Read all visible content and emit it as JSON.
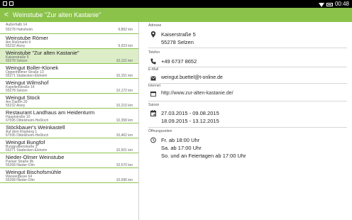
{
  "status_bar": {
    "time": "00:48",
    "icons": [
      "square-icon",
      "square-icon",
      "wifi-icon",
      "battery-icon"
    ]
  },
  "toolbar": {
    "back_glyph": "<",
    "title": "Weinstube \"Zur alten Kastanie\""
  },
  "list": {
    "items": [
      {
        "name": "",
        "street": "Außerhalb 14",
        "city": "55278 Hahnheim",
        "distance": "9,892 km"
      },
      {
        "name": "Weinstube Römer",
        "street": "Am Roßmarkt 4",
        "city": "55232 Alzey",
        "distance": "9,923 km"
      },
      {
        "name": "Weinstube \"Zur alten Kastanie\"",
        "street": "Kaiserstraße 5",
        "city": "55278 Selzen",
        "distance": "10,121 km"
      },
      {
        "name": "Weingut Boller-Klonek",
        "street": "Oppenheimer Straße 13",
        "city": "55271 Stadecken-Elsheim",
        "distance": "10,151 km"
      },
      {
        "name": "Weingut Wilmshof",
        "street": "Kapellenstraße 14",
        "city": "55278 Selzen",
        "distance": "10,172 km"
      },
      {
        "name": "Weingut Stock",
        "street": "Am Damm 20",
        "city": "55232 Alzey",
        "distance": "10,210 km"
      },
      {
        "name": "Restaurant Landhaus am Heidenturm",
        "street": "Hauptstraße 10",
        "city": "67595 Dittelsheim-Heßloch",
        "distance": "10,358 km"
      },
      {
        "name": "Stöckbauer's Weinkastell",
        "street": "Auf dem Klopberg 1",
        "city": "67595 Dittelsheim-Heßloch",
        "distance": "10,462 km"
      },
      {
        "name": "Weingut Bungfof",
        "street": "Burggrabenstraße 3",
        "city": "55271 Stadecken-Elsheim",
        "distance": "10,501 km"
      },
      {
        "name": "Nieder-Olmer Weinstube",
        "street": "Pariser Straße 9b",
        "city": "55268 Nieder-Olm",
        "distance": "10,570 km"
      },
      {
        "name": "Weingut Bischofsmühle",
        "street": "Wassergasse 64",
        "city": "55268 Nieder-Olm",
        "distance": "10,696 km"
      }
    ],
    "selected_index": 2
  },
  "detail": {
    "address": {
      "label": "Adresse",
      "street": "Kaiserstraße 5",
      "city": "55278 Selzen"
    },
    "phone": {
      "label": "Telefon",
      "value": "+49 6737 8652"
    },
    "email": {
      "label": "E-Mail",
      "value": "weingut.buettel@t-online.de"
    },
    "website": {
      "label": "Internet",
      "value": "http://www.zur-alten-kastanie.de/"
    },
    "season": {
      "label": "Saison",
      "line1": "27.03.2015 - 09.08.2015",
      "line2": "18.09.2015 - 13.12.2015"
    },
    "hours": {
      "label": "Öffnungszeiten",
      "line1": "Fr. ab 18:00 Uhr",
      "line2": "Sa. ab 17:00 Uhr",
      "line3": "So. und an Feiertagen ab 17:00 Uhr"
    }
  },
  "colors": {
    "accent": "#8bc34a",
    "selected_row": "#dcedc8",
    "status_bar": "#000000"
  }
}
